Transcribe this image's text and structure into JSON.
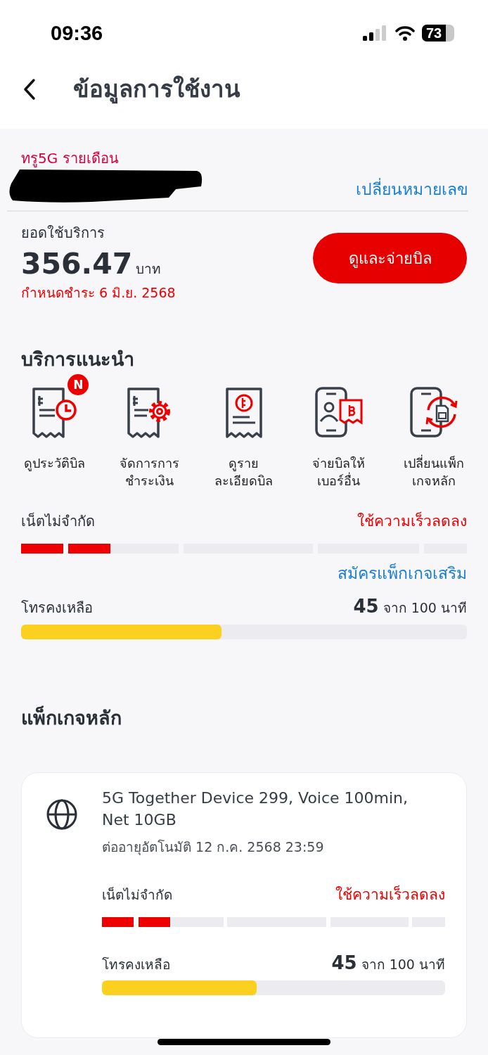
{
  "status_bar": {
    "time": "09:36",
    "battery": "73"
  },
  "header": {
    "title": "ข้อมูลการใช้งาน"
  },
  "account": {
    "plan": "ทรู5G รายเดือน",
    "change_number_link": "เปลี่ยนหมายเลข"
  },
  "bill": {
    "label": "ยอดใช้บริการ",
    "amount": "356.47",
    "currency": "บาท",
    "due": "กำหนดชำระ 6 มิ.ย. 2568",
    "pay_button": "ดูและจ่ายบิล"
  },
  "services": {
    "title": "บริการแนะนำ",
    "items": [
      {
        "kind": "bill-history",
        "label": "ดูประวัติบิล",
        "badge": "N"
      },
      {
        "kind": "payment-settings",
        "label": "จัดการการ\nชำระเงิน"
      },
      {
        "kind": "bill-details",
        "label": "ดูราย\nละเอียดบิล"
      },
      {
        "kind": "pay-other",
        "label": "จ่ายบิลให้\nเบอร์อื่น"
      },
      {
        "kind": "change-package",
        "label": "เปลี่ยนแพ็ก\nเกจหลัก"
      }
    ]
  },
  "usage": {
    "net_label": "เน็ตไม่จำกัด",
    "net_status": "ใช้ความเร็วลดลง",
    "net_bar": {
      "level": 0.2
    },
    "addon_link": "สมัครแพ็กเกจเสริม",
    "voice_label": "โทรคงเหลือ",
    "voice_amount": "45",
    "voice_total": "จาก 100 นาที",
    "voice_bar": {
      "level": 0.45
    }
  },
  "main_package": {
    "title": "แพ็กเกจหลัก",
    "name": "5G Together Device 299, Voice 100min, Net 10GB",
    "renewal": "ต่ออายุอัตโนมัติ 12 ก.ค. 2568 23:59",
    "net_label": "เน็ตไม่จำกัด",
    "net_status": "ใช้ความเร็วลดลง",
    "net_bar": {
      "level": 0.2
    },
    "voice_label": "โทรคงเหลือ",
    "voice_amount": "45",
    "voice_total": "จาก 100 นาที",
    "voice_bar": {
      "level": 0.45
    }
  }
}
